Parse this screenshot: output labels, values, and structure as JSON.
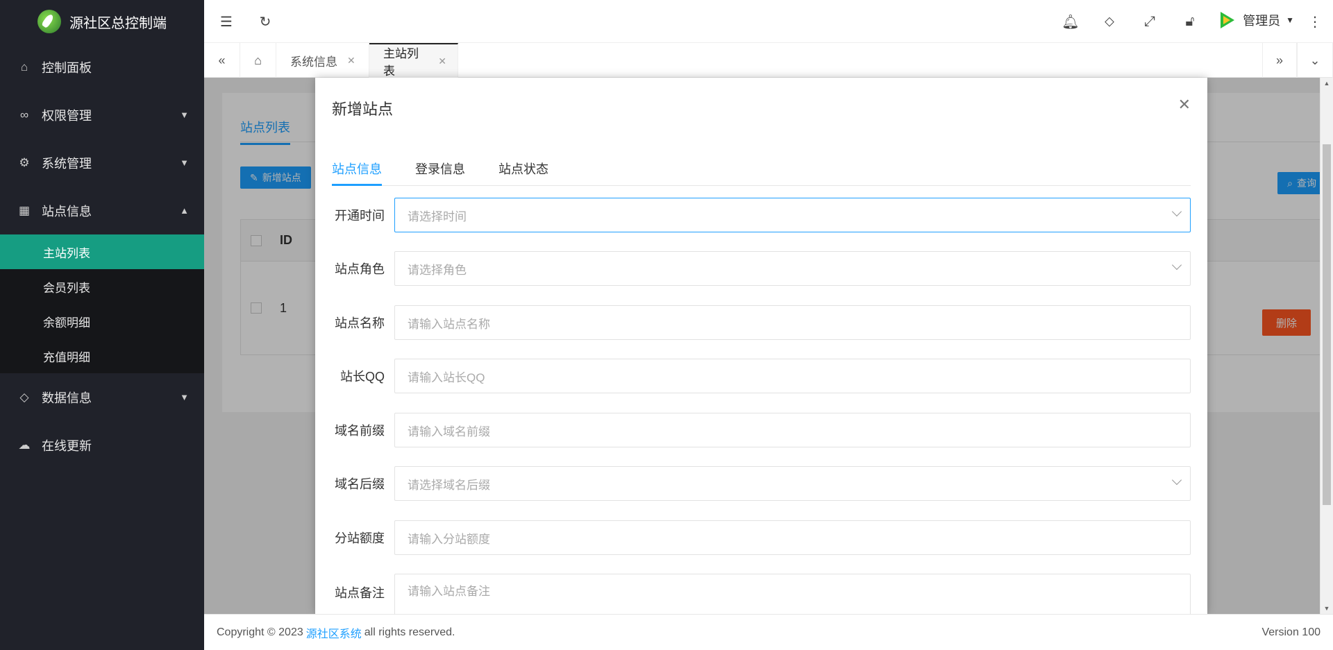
{
  "app": {
    "title": "源社区总控制端"
  },
  "sidebar": {
    "items": [
      {
        "label": "控制面板",
        "icon": "home-icon"
      },
      {
        "label": "权限管理",
        "icon": "link-icon"
      },
      {
        "label": "系统管理",
        "icon": "gear-icon"
      },
      {
        "label": "站点信息",
        "icon": "apps-icon"
      },
      {
        "label": "数据信息",
        "icon": "diamond-icon"
      },
      {
        "label": "在线更新",
        "icon": "cloud-upload-icon"
      }
    ],
    "sub_items": [
      "主站列表",
      "会员列表",
      "余额明细",
      "充值明细"
    ]
  },
  "header": {
    "user": "管理员"
  },
  "tabs": [
    {
      "label": "系统信息"
    },
    {
      "label": "主站列表"
    }
  ],
  "content": {
    "card_tab": "站点列表",
    "add_button": "新增站点",
    "query_button": "查询",
    "table": {
      "col_id": "ID",
      "row_id": "1",
      "delete_button": "删除"
    }
  },
  "modal": {
    "title": "新增站点",
    "tabs": [
      "站点信息",
      "登录信息",
      "站点状态"
    ],
    "fields": [
      {
        "label": "开通时间",
        "placeholder": "请选择时间",
        "type": "select"
      },
      {
        "label": "站点角色",
        "placeholder": "请选择角色",
        "type": "select"
      },
      {
        "label": "站点名称",
        "placeholder": "请输入站点名称",
        "type": "input"
      },
      {
        "label": "站长QQ",
        "placeholder": "请输入站长QQ",
        "type": "input"
      },
      {
        "label": "域名前缀",
        "placeholder": "请输入域名前缀",
        "type": "input"
      },
      {
        "label": "域名后缀",
        "placeholder": "请选择域名后缀",
        "type": "select"
      },
      {
        "label": "分站额度",
        "placeholder": "请输入分站额度",
        "type": "input"
      },
      {
        "label": "站点备注",
        "placeholder": "请输入站点备注",
        "type": "textarea"
      }
    ]
  },
  "footer": {
    "prefix": "Copyright © 2023",
    "link": "源社区系统",
    "suffix": "all rights reserved.",
    "version": "Version 100"
  },
  "colors": {
    "accent": "#1e9fff",
    "active_menu": "#169d82",
    "sidebar_bg": "#20222a",
    "danger": "#ff5722"
  }
}
